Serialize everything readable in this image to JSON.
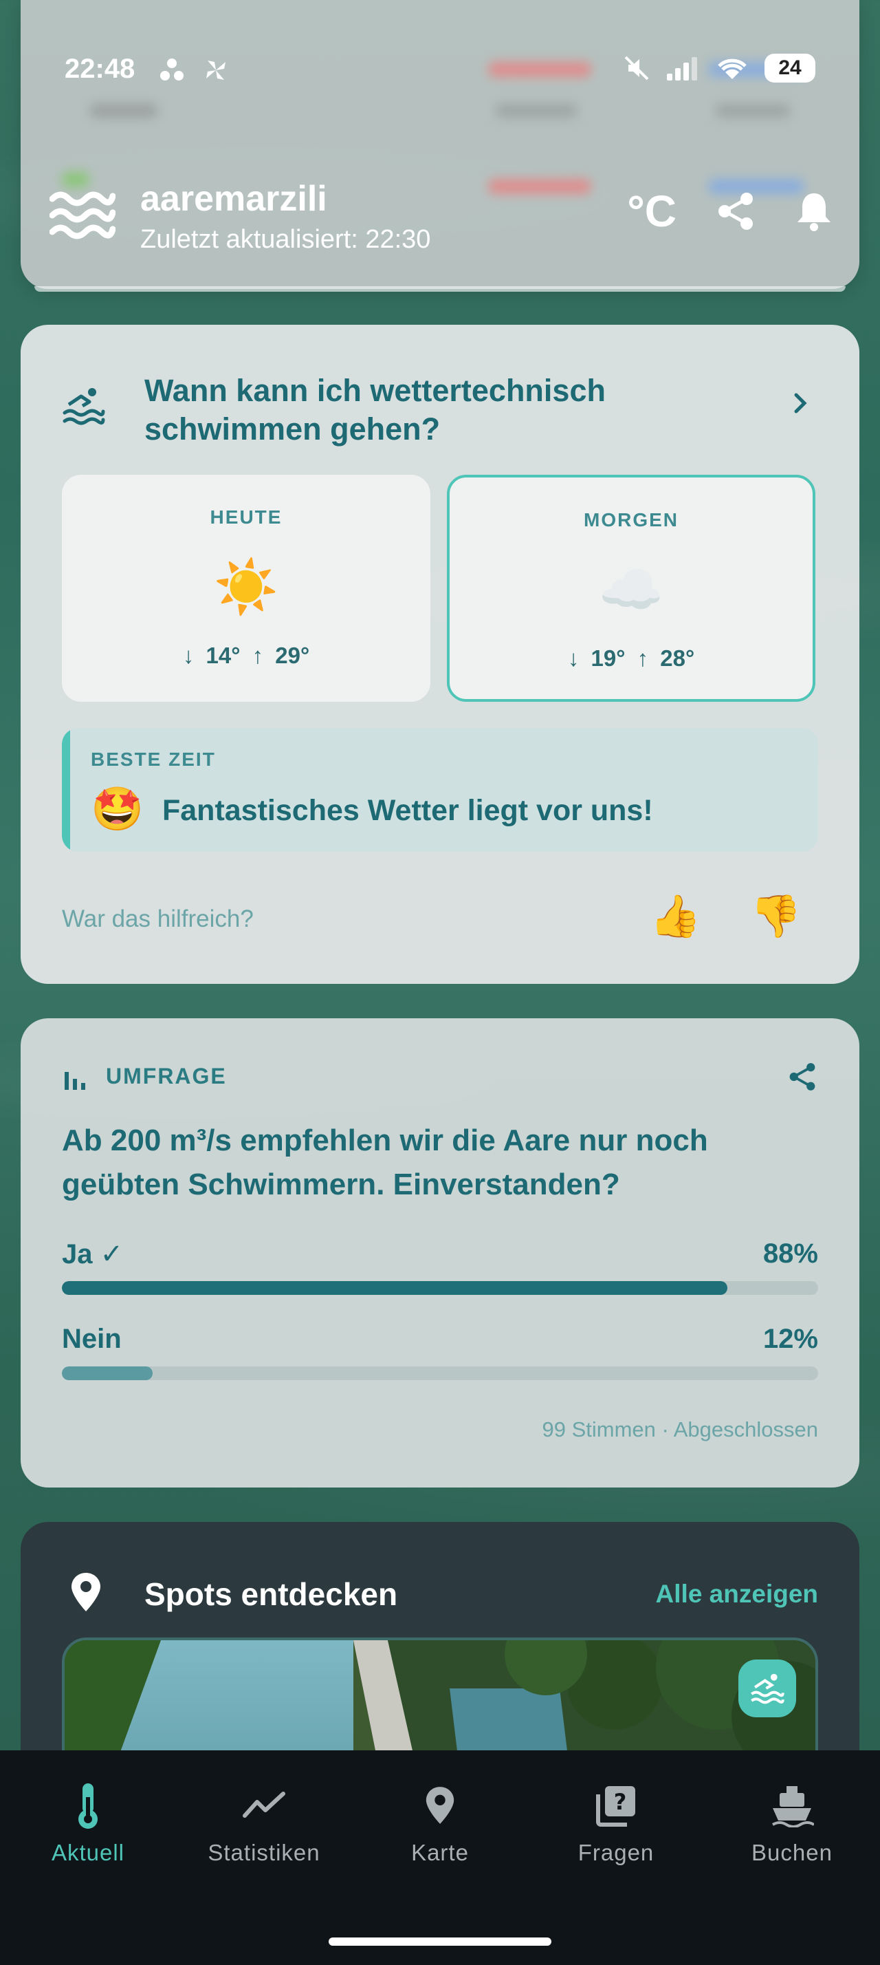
{
  "status_bar": {
    "time": "22:48",
    "battery": "24"
  },
  "header": {
    "app_name": "aaremarzili",
    "last_updated": "Zuletzt aktualisiert: 22:30",
    "unit_label": "°C"
  },
  "weather_card": {
    "title": "Wann kann ich wettertechnisch schwimmen gehen?",
    "today": {
      "label": "HEUTE",
      "icon": "☀️",
      "temps": "↓ 14°   ↑ 29°"
    },
    "tomorrow": {
      "label": "MORGEN",
      "icon": "☁️",
      "temps": "↓ 19°   ↑ 28°"
    },
    "best_time": {
      "label": "BESTE ZEIT",
      "emoji": "🤩",
      "text": "Fantastisches Wetter liegt vor uns!"
    },
    "feedback": {
      "question": "War das hilfreich?",
      "up": "👍",
      "down": "👎"
    }
  },
  "poll": {
    "label": "UMFRAGE",
    "question": "Ab 200 m³/s empfehlen wir die Aare nur noch geübten Schwimmern. Einverstanden?",
    "options": [
      {
        "name": "Ja ✓",
        "percent_label": "88%",
        "percent": 88,
        "color": "#1f6f78"
      },
      {
        "name": "Nein",
        "percent_label": "12%",
        "percent": 12,
        "color": "#5a9aa0"
      }
    ],
    "footer": "99 Stimmen · Abgeschlossen"
  },
  "spots": {
    "title": "Spots entdecken",
    "show_all": "Alle anzeigen"
  },
  "bottom_nav": {
    "items": [
      {
        "label": "Aktuell",
        "icon": "thermometer-icon"
      },
      {
        "label": "Statistiken",
        "icon": "trend-icon"
      },
      {
        "label": "Karte",
        "icon": "map-pin-icon"
      },
      {
        "label": "Fragen",
        "icon": "question-icon"
      },
      {
        "label": "Buchen",
        "icon": "boat-icon"
      }
    ],
    "active_index": 0
  },
  "colors": {
    "accent": "#4fc5b8",
    "primary_text": "#1d6a75",
    "nav_bg": "#0f1418"
  }
}
